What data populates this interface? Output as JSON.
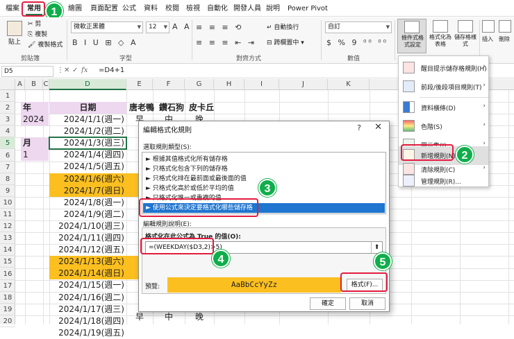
{
  "tabs": [
    "檔案",
    "常用",
    "插入",
    "繪圖",
    "頁面配置",
    "公式",
    "資料",
    "校閱",
    "檢視",
    "自動化",
    "開發人員",
    "說明",
    "Power Pivot"
  ],
  "ribbon": {
    "paste": "貼上",
    "cut": "剪",
    "copy": "複製",
    "format_painter": "複製格式",
    "clipboard_label": "剪貼簿",
    "font_name": "微軟正黑體",
    "font_size": "12",
    "font_label": "字型",
    "wrap_text": "自動換行",
    "merge_center": "跨欄置中",
    "alignment_label": "對齊方式",
    "number_format": "自訂",
    "number_label": "數值",
    "cond_format": "條件式格式設定",
    "format_table": "格式化為表格",
    "cell_style": "儲存格樣式",
    "insert": "插入",
    "delete": "刪除",
    "font_icons": "B I U ⊞ ◇ A",
    "align_icons1": "≡ ≡ ≡ ⟲",
    "align_icons2": "≡ ≡ ≡ ⇤ ⇥",
    "number_icons": "$ % 9 ⁰⁰ ⁰⁰"
  },
  "formula_bar": {
    "name_box": "D5",
    "fx": "fx",
    "formula": "=D4+1"
  },
  "columns": [
    "A",
    "B",
    "C",
    "D",
    "E",
    "F",
    "G",
    "H",
    "I",
    "J",
    "K"
  ],
  "rows": [
    "1",
    "2",
    "3",
    "4",
    "5",
    "6",
    "7",
    "8",
    "9",
    "10",
    "11",
    "12",
    "13",
    "14",
    "15",
    "16",
    "17",
    "18",
    "19",
    "20"
  ],
  "sheet": {
    "year_label": "年",
    "year_value": "2024",
    "month_label": "月",
    "month_value": "1",
    "header_date": "日期",
    "header_e": "唐老鴨",
    "header_f": "鑽石狗",
    "header_g": "皮卡丘",
    "row3_e": "早",
    "row3_f": "中",
    "row3_g": "晚",
    "row20_e": "早",
    "row20_f": "中",
    "row20_g": "晚",
    "dates": [
      {
        "text": "2024/1/1(週一)",
        "weekend": false
      },
      {
        "text": "2024/1/2(週二)",
        "weekend": false
      },
      {
        "text": "2024/1/3(週三)",
        "weekend": false
      },
      {
        "text": "2024/1/4(週四)",
        "weekend": false
      },
      {
        "text": "2024/1/5(週五)",
        "weekend": false
      },
      {
        "text": "2024/1/6(週六)",
        "weekend": true
      },
      {
        "text": "2024/1/7(週日)",
        "weekend": true
      },
      {
        "text": "2024/1/8(週一)",
        "weekend": false
      },
      {
        "text": "2024/1/9(週二)",
        "weekend": false
      },
      {
        "text": "2024/1/10(週三)",
        "weekend": false
      },
      {
        "text": "2024/1/11(週四)",
        "weekend": false
      },
      {
        "text": "2024/1/12(週五)",
        "weekend": false
      },
      {
        "text": "2024/1/13(週六)",
        "weekend": true
      },
      {
        "text": "2024/1/14(週日)",
        "weekend": true
      },
      {
        "text": "2024/1/15(週一)",
        "weekend": false
      },
      {
        "text": "2024/1/16(週二)",
        "weekend": false
      },
      {
        "text": "2024/1/17(週三)",
        "weekend": false
      },
      {
        "text": "2024/1/18(週四)",
        "weekend": false
      },
      {
        "text": "2024/1/19(週五)",
        "weekend": false
      }
    ]
  },
  "cf_menu": {
    "items": [
      {
        "label": "醒目提示儲存格規則(H)",
        "arrow": "›"
      },
      {
        "label": "前段/後段項目規則(T)",
        "arrow": "›"
      },
      {
        "label": "資料橫條(D)",
        "arrow": "›"
      },
      {
        "label": "色階(S)",
        "arrow": "›"
      },
      {
        "label": "圖示集(I)",
        "arrow": "›"
      },
      {
        "label": "新增規則(N)...",
        "arrow": ""
      },
      {
        "label": "清除規則(C)",
        "arrow": "›"
      },
      {
        "label": "管理規則(R)...",
        "arrow": ""
      }
    ]
  },
  "dialog": {
    "title": "編輯格式化規則",
    "help": "?",
    "close": "✕",
    "select_rule_type": "選取規則類型(S):",
    "rule_types": [
      "► 根據其值格式化所有儲存格",
      "► 只格式化包含下列的儲存格",
      "► 只格式化排在最前面或最後面的值",
      "► 只格式化高於或低於平均的值",
      "► 只格式化唯一或重複的值",
      "► 使用公式來決定要格式化哪些儲存格"
    ],
    "edit_desc": "編輯規則說明(E):",
    "formula_label": "格式化在此公式為 True 的值(O):",
    "formula_value": "=(WEEKDAY($D3,2)>5)",
    "upload_icon": "⬆",
    "preview_label": "預覽:",
    "preview_text": "AaBbCcYyZz",
    "format_button": "格式(F)...",
    "ok_button": "確定",
    "cancel_button": "取消"
  },
  "badges": [
    "1",
    "2",
    "3",
    "4",
    "5"
  ],
  "colors": {
    "accent": "#217346",
    "weekend": "#fbbf20",
    "header_fill": "#eed8f0",
    "highlight": "#e41b3f",
    "badge": "#0fae4b",
    "selection": "#1f75cf"
  }
}
